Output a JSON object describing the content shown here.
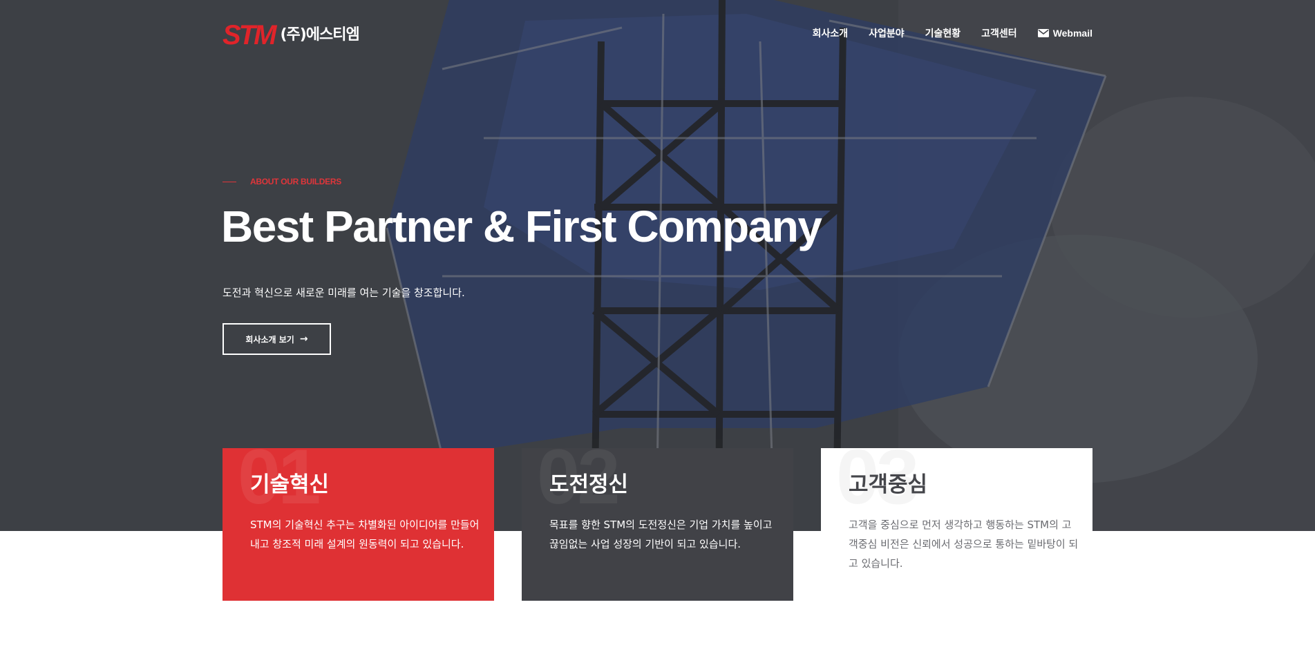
{
  "brand": {
    "logo_mark": "STM",
    "logo_korean": "(주)에스티엠"
  },
  "nav": {
    "items": [
      "회사소개",
      "사업분야",
      "기술현황",
      "고객센터"
    ],
    "webmail": {
      "icon": "envelope-icon",
      "label": "Webmail"
    }
  },
  "hero": {
    "eyebrow": "ABOUT OUR BUILDERS",
    "headline": "Best Partner & First Company",
    "subtext": "도전과 혁신으로 새로운 미래를 여는 기술을 창조합니다.",
    "cta_label": "회사소개 보기",
    "cta_icon": "arrow-right-icon"
  },
  "cards": [
    {
      "number": "01",
      "title": "기술혁신",
      "text": "STM의 기술혁신 추구는 차별화된 아이디어를 만들어내고 창조적 미래 설계의 원동력이 되고 있습니다.",
      "bg": "#df3134"
    },
    {
      "number": "02",
      "title": "도전정신",
      "text": "목표를 향한 STM의 도전정신은 기업 가치를 높이고 끊임없는 사업 성장의 기반이 되고 있습니다.",
      "bg": "#414247"
    },
    {
      "number": "03",
      "title": "고객중심",
      "text": "고객을 중심으로 먼저 생각하고 행동하는 STM의 고객중심 비전은 신뢰에서 성공으로 통하는 밑바탕이 되고 있습니다.",
      "bg": "#ffffff"
    }
  ],
  "colors": {
    "accent": "#e0353a",
    "hero_overlay": "#3d3f45",
    "card_dark": "#414247"
  }
}
